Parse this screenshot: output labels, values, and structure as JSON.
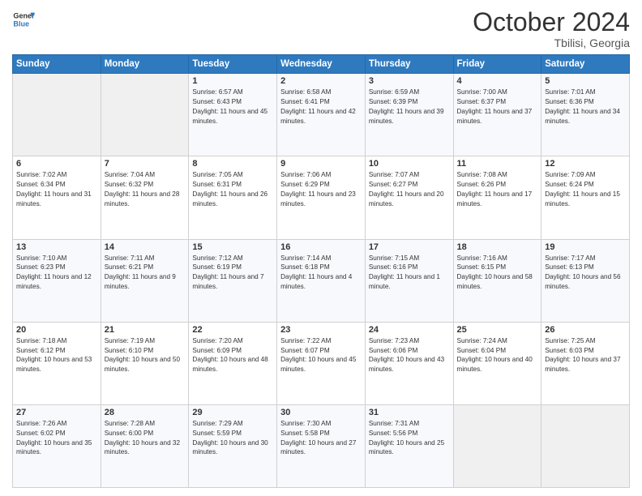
{
  "header": {
    "logo_line1": "General",
    "logo_line2": "Blue",
    "month": "October 2024",
    "location": "Tbilisi, Georgia"
  },
  "weekdays": [
    "Sunday",
    "Monday",
    "Tuesday",
    "Wednesday",
    "Thursday",
    "Friday",
    "Saturday"
  ],
  "weeks": [
    [
      {
        "day": "",
        "empty": true
      },
      {
        "day": "",
        "empty": true
      },
      {
        "day": "1",
        "sunrise": "6:57 AM",
        "sunset": "6:43 PM",
        "daylight": "11 hours and 45 minutes."
      },
      {
        "day": "2",
        "sunrise": "6:58 AM",
        "sunset": "6:41 PM",
        "daylight": "11 hours and 42 minutes."
      },
      {
        "day": "3",
        "sunrise": "6:59 AM",
        "sunset": "6:39 PM",
        "daylight": "11 hours and 39 minutes."
      },
      {
        "day": "4",
        "sunrise": "7:00 AM",
        "sunset": "6:37 PM",
        "daylight": "11 hours and 37 minutes."
      },
      {
        "day": "5",
        "sunrise": "7:01 AM",
        "sunset": "6:36 PM",
        "daylight": "11 hours and 34 minutes."
      }
    ],
    [
      {
        "day": "6",
        "sunrise": "7:02 AM",
        "sunset": "6:34 PM",
        "daylight": "11 hours and 31 minutes."
      },
      {
        "day": "7",
        "sunrise": "7:04 AM",
        "sunset": "6:32 PM",
        "daylight": "11 hours and 28 minutes."
      },
      {
        "day": "8",
        "sunrise": "7:05 AM",
        "sunset": "6:31 PM",
        "daylight": "11 hours and 26 minutes."
      },
      {
        "day": "9",
        "sunrise": "7:06 AM",
        "sunset": "6:29 PM",
        "daylight": "11 hours and 23 minutes."
      },
      {
        "day": "10",
        "sunrise": "7:07 AM",
        "sunset": "6:27 PM",
        "daylight": "11 hours and 20 minutes."
      },
      {
        "day": "11",
        "sunrise": "7:08 AM",
        "sunset": "6:26 PM",
        "daylight": "11 hours and 17 minutes."
      },
      {
        "day": "12",
        "sunrise": "7:09 AM",
        "sunset": "6:24 PM",
        "daylight": "11 hours and 15 minutes."
      }
    ],
    [
      {
        "day": "13",
        "sunrise": "7:10 AM",
        "sunset": "6:23 PM",
        "daylight": "11 hours and 12 minutes."
      },
      {
        "day": "14",
        "sunrise": "7:11 AM",
        "sunset": "6:21 PM",
        "daylight": "11 hours and 9 minutes."
      },
      {
        "day": "15",
        "sunrise": "7:12 AM",
        "sunset": "6:19 PM",
        "daylight": "11 hours and 7 minutes."
      },
      {
        "day": "16",
        "sunrise": "7:14 AM",
        "sunset": "6:18 PM",
        "daylight": "11 hours and 4 minutes."
      },
      {
        "day": "17",
        "sunrise": "7:15 AM",
        "sunset": "6:16 PM",
        "daylight": "11 hours and 1 minute."
      },
      {
        "day": "18",
        "sunrise": "7:16 AM",
        "sunset": "6:15 PM",
        "daylight": "10 hours and 58 minutes."
      },
      {
        "day": "19",
        "sunrise": "7:17 AM",
        "sunset": "6:13 PM",
        "daylight": "10 hours and 56 minutes."
      }
    ],
    [
      {
        "day": "20",
        "sunrise": "7:18 AM",
        "sunset": "6:12 PM",
        "daylight": "10 hours and 53 minutes."
      },
      {
        "day": "21",
        "sunrise": "7:19 AM",
        "sunset": "6:10 PM",
        "daylight": "10 hours and 50 minutes."
      },
      {
        "day": "22",
        "sunrise": "7:20 AM",
        "sunset": "6:09 PM",
        "daylight": "10 hours and 48 minutes."
      },
      {
        "day": "23",
        "sunrise": "7:22 AM",
        "sunset": "6:07 PM",
        "daylight": "10 hours and 45 minutes."
      },
      {
        "day": "24",
        "sunrise": "7:23 AM",
        "sunset": "6:06 PM",
        "daylight": "10 hours and 43 minutes."
      },
      {
        "day": "25",
        "sunrise": "7:24 AM",
        "sunset": "6:04 PM",
        "daylight": "10 hours and 40 minutes."
      },
      {
        "day": "26",
        "sunrise": "7:25 AM",
        "sunset": "6:03 PM",
        "daylight": "10 hours and 37 minutes."
      }
    ],
    [
      {
        "day": "27",
        "sunrise": "7:26 AM",
        "sunset": "6:02 PM",
        "daylight": "10 hours and 35 minutes."
      },
      {
        "day": "28",
        "sunrise": "7:28 AM",
        "sunset": "6:00 PM",
        "daylight": "10 hours and 32 minutes."
      },
      {
        "day": "29",
        "sunrise": "7:29 AM",
        "sunset": "5:59 PM",
        "daylight": "10 hours and 30 minutes."
      },
      {
        "day": "30",
        "sunrise": "7:30 AM",
        "sunset": "5:58 PM",
        "daylight": "10 hours and 27 minutes."
      },
      {
        "day": "31",
        "sunrise": "7:31 AM",
        "sunset": "5:56 PM",
        "daylight": "10 hours and 25 minutes."
      },
      {
        "day": "",
        "empty": true
      },
      {
        "day": "",
        "empty": true
      }
    ]
  ]
}
